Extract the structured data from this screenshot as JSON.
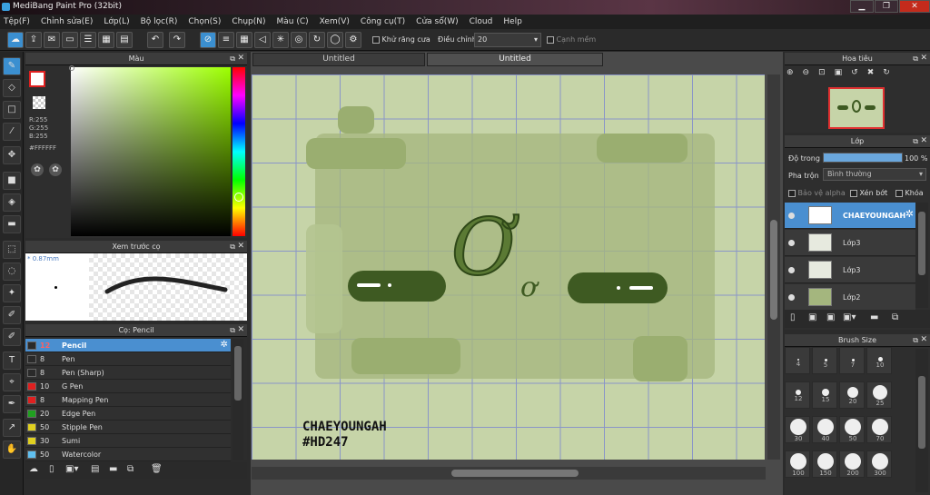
{
  "window": {
    "title": "MediBang Paint Pro (32bit)",
    "minimize": "▁",
    "restore": "❐",
    "close": "✕"
  },
  "menu": [
    "Tệp(F)",
    "Chỉnh sửa(E)",
    "Lớp(L)",
    "Bộ lọc(R)",
    "Chọn(S)",
    "Chụp(N)",
    "Màu (C)",
    "Xem(V)",
    "Công cụ(T)",
    "Cửa sổ(W)",
    "Cloud",
    "Help"
  ],
  "toolbar": {
    "antialias_label": "Khử răng cưa",
    "adjust_label": "Điều chỉnh",
    "adjust_value": "20",
    "edge_label": "Cạnh mềm"
  },
  "color_panel": {
    "title": "Màu",
    "r": "R:255",
    "g": "G:255",
    "b": "B:255",
    "hex": "#FFFFFF"
  },
  "brush_preview": {
    "title": "Xem trước cọ",
    "size": "* 0.87mm"
  },
  "brush_panel": {
    "title": "Cọ: Pencil",
    "items": [
      {
        "size": "12",
        "name": "Pencil",
        "color": "#2a2a2a",
        "selected": true
      },
      {
        "size": "8",
        "name": "Pen",
        "color": "#2a2a2a"
      },
      {
        "size": "8",
        "name": "Pen (Sharp)",
        "color": "#2a2a2a"
      },
      {
        "size": "10",
        "name": "G Pen",
        "color": "#e02020"
      },
      {
        "size": "8",
        "name": "Mapping Pen",
        "color": "#e02020"
      },
      {
        "size": "20",
        "name": "Edge Pen",
        "color": "#20a020"
      },
      {
        "size": "50",
        "name": "Stipple Pen",
        "color": "#e0d020"
      },
      {
        "size": "30",
        "name": "Sumi",
        "color": "#e0d020"
      },
      {
        "size": "50",
        "name": "Watercolor",
        "color": "#60c0f0"
      }
    ]
  },
  "tabs": [
    "Untitled",
    "Untitled"
  ],
  "canvas": {
    "logo_text": "Ơ",
    "logo_small": "ơ",
    "signature_line1": "CHAEYOUNGAH",
    "signature_line2": "#HD247"
  },
  "navigator": {
    "title": "Hoa tiêu"
  },
  "layers": {
    "title": "Lớp",
    "opacity_label": "Độ trong",
    "opacity_value": "100 %",
    "opacity": 1.0,
    "blend_label": "Pha trộn",
    "blend_value": "Bình thường",
    "protect_alpha": "Bảo vệ alpha",
    "clipping": "Xén bớt",
    "lock": "Khóa",
    "items": [
      {
        "name": "CHAEYOUNGAH",
        "selected": true
      },
      {
        "name": "Lớp3"
      },
      {
        "name": "Lớp3"
      },
      {
        "name": "Lớp2"
      }
    ]
  },
  "brush_size": {
    "title": "Brush Size",
    "sizes": [
      "4",
      "5",
      "7",
      "10",
      "12",
      "15",
      "20",
      "25",
      "30",
      "40",
      "50",
      "70",
      "100",
      "150",
      "200",
      "300"
    ]
  },
  "colors": {
    "accent": "#3b8fd0",
    "canvas_bg": "#c6d4a8",
    "dark_green": "#3e5a22"
  }
}
